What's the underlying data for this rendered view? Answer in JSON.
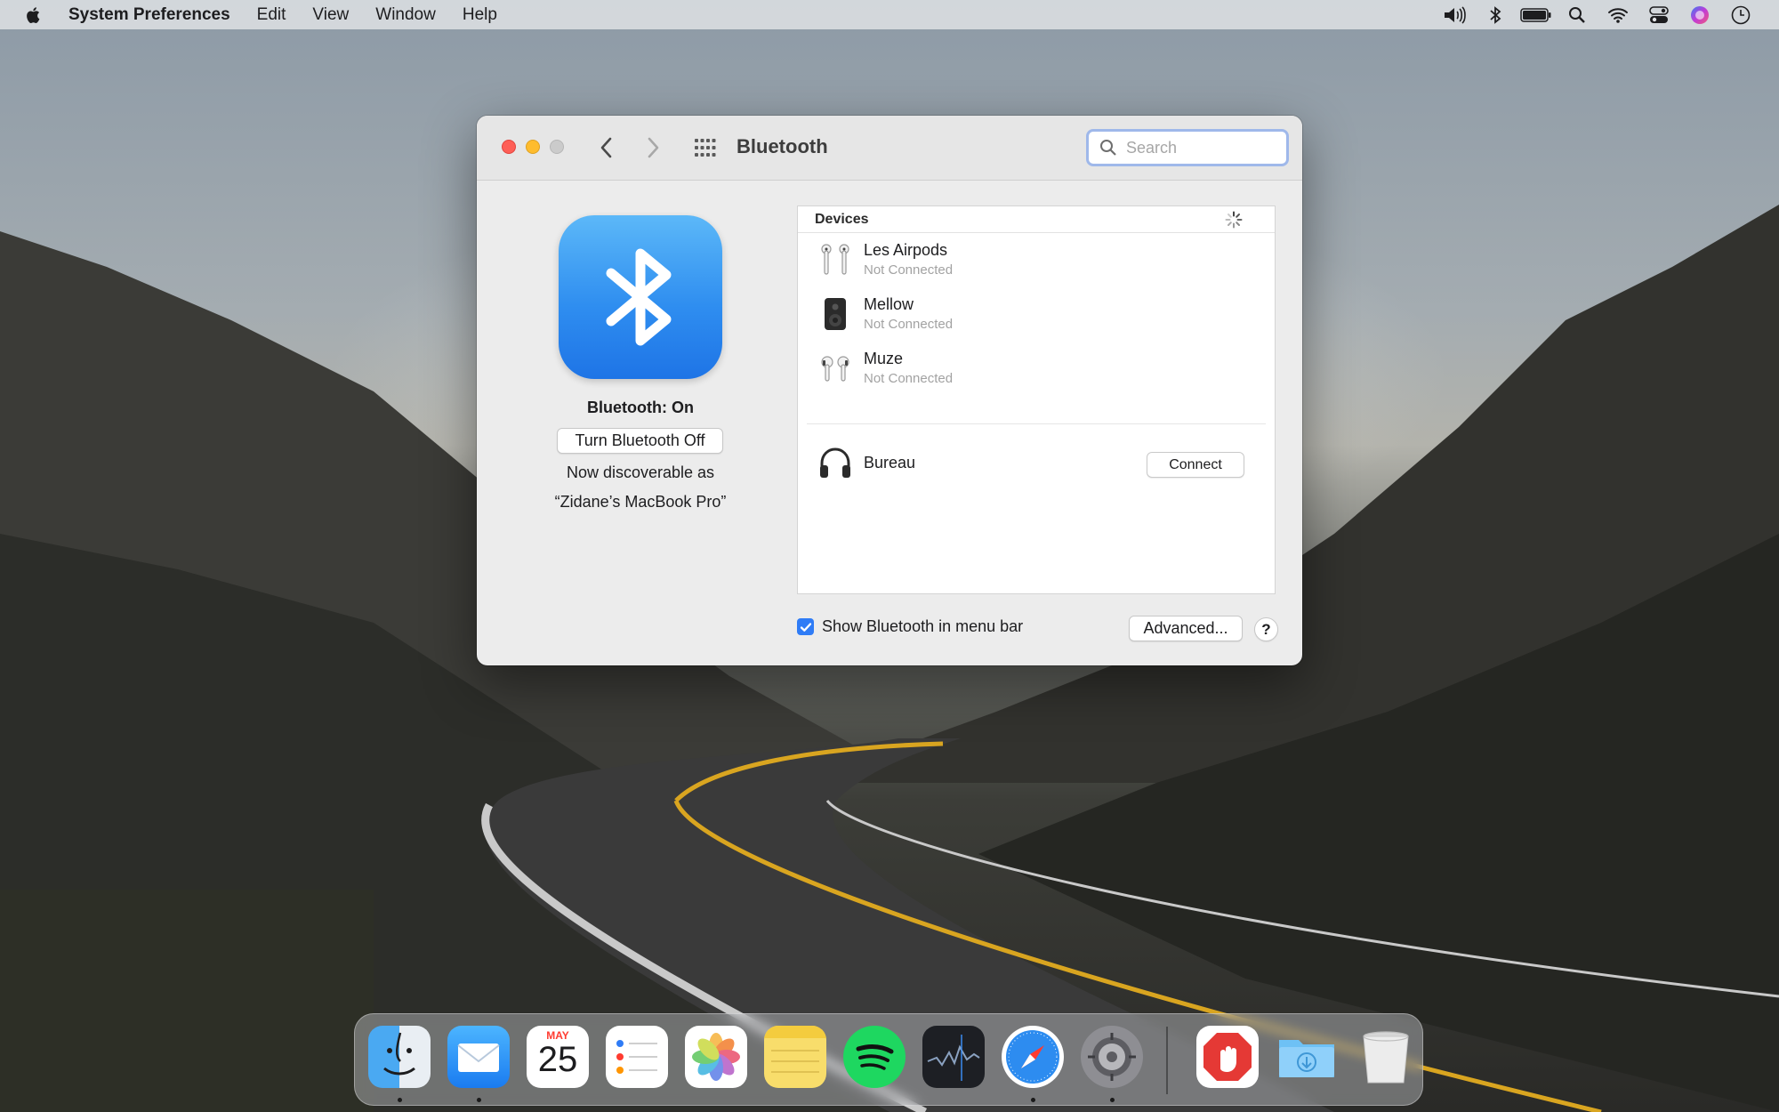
{
  "colors": {
    "accent": "#2f7cf6",
    "close": "#fe5f57",
    "minimize": "#febc2e",
    "zoom_inactive": "#cbcbcb"
  },
  "menubar": {
    "apple_icon": "apple-icon",
    "app_name": "System Preferences",
    "items": [
      "Edit",
      "View",
      "Window",
      "Help"
    ],
    "status_icons": [
      "volume-icon",
      "bluetooth-icon",
      "battery-icon",
      "spotlight-icon",
      "wifi-icon",
      "control-center-icon",
      "siri-icon",
      "clock-icon"
    ]
  },
  "window": {
    "title": "Bluetooth",
    "search": {
      "placeholder": "Search",
      "value": ""
    },
    "left": {
      "status": "Bluetooth: On",
      "toggle_label": "Turn Bluetooth Off",
      "discover_line1": "Now discoverable as",
      "discover_line2": "“Zidane’s MacBook Pro”"
    },
    "devices": {
      "header": "Devices",
      "paired": [
        {
          "name": "Les Airpods",
          "status": "Not Connected",
          "icon": "airpods-icon"
        },
        {
          "name": "Mellow",
          "status": "Not Connected",
          "icon": "speaker-icon"
        },
        {
          "name": "Muze",
          "status": "Not Connected",
          "icon": "airpods-icon"
        }
      ],
      "nearby": [
        {
          "name": "Bureau",
          "icon": "headphones-icon",
          "action": "Connect"
        }
      ]
    },
    "show_in_menubar": {
      "label": "Show Bluetooth in menu bar",
      "checked": true
    },
    "advanced_label": "Advanced...",
    "help_label": "?"
  },
  "dock": {
    "apps": [
      "finder-icon",
      "mail-icon",
      "calendar-icon",
      "reminders-icon",
      "photos-icon",
      "notes-icon",
      "spotify-icon",
      "stocks-icon",
      "safari-icon",
      "system-preferences-icon",
      "adblock-icon",
      "downloads-folder-icon",
      "trash-icon"
    ],
    "calendar": {
      "month": "MAY",
      "day": "25"
    },
    "running": [
      "finder-icon",
      "mail-icon",
      "safari-icon",
      "system-preferences-icon"
    ]
  }
}
